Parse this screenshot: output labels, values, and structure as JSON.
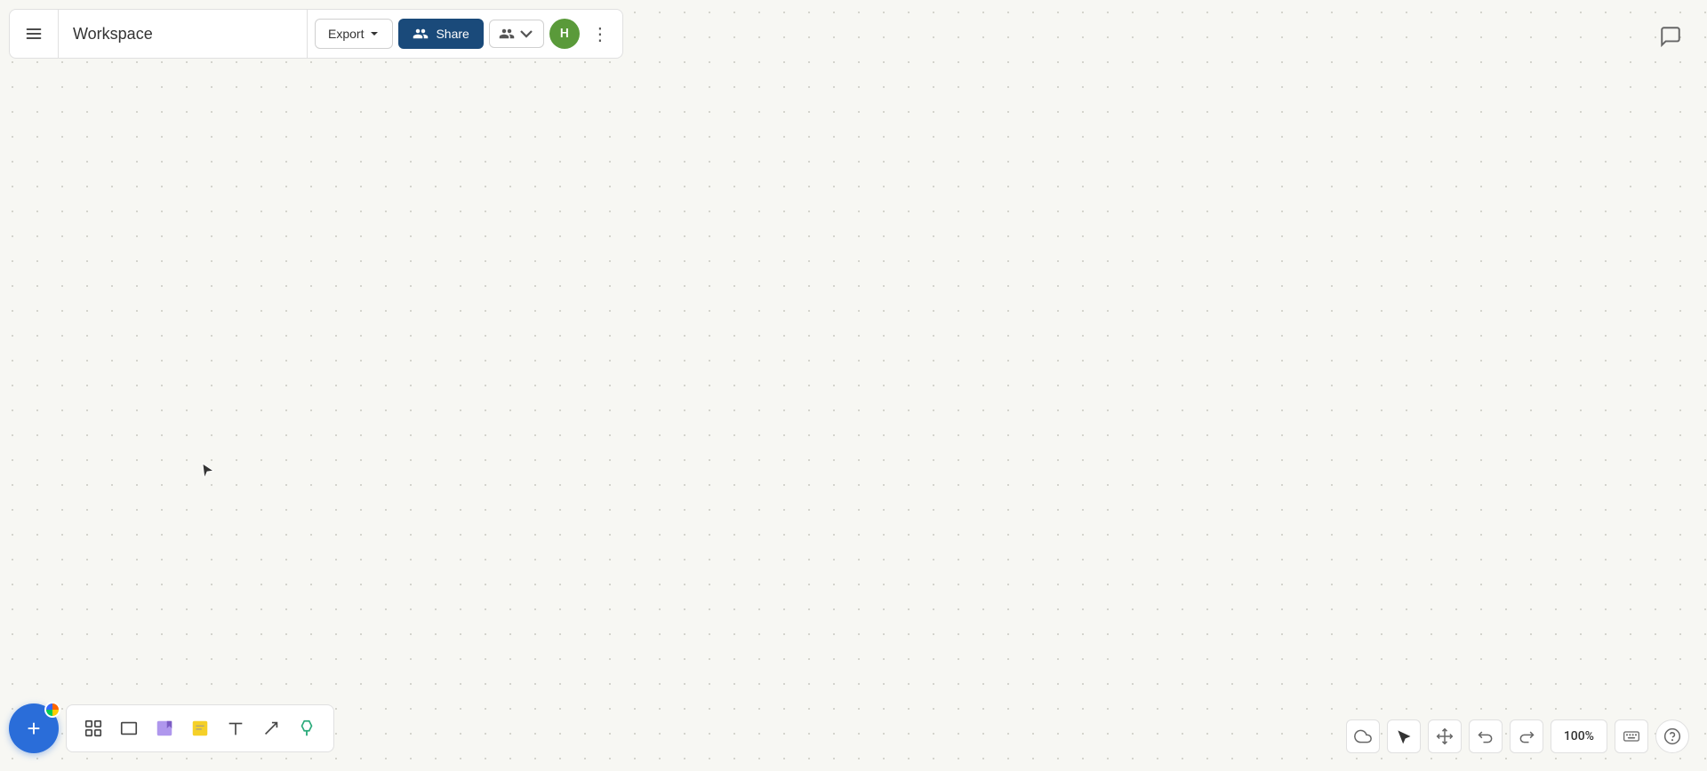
{
  "app": {
    "title": "Workspace"
  },
  "toolbar": {
    "menu_label": "Menu",
    "title": "Workspace",
    "export_label": "Export",
    "share_label": "Share",
    "zoom_value": "100%"
  },
  "user": {
    "avatar_letter": "H",
    "avatar_color": "#5a9a3a"
  },
  "tools": {
    "add_label": "+",
    "items": [
      {
        "name": "frames",
        "icon": "⬚",
        "label": "Frames"
      },
      {
        "name": "rectangle",
        "icon": "□",
        "label": "Rectangle"
      },
      {
        "name": "sticky",
        "icon": "▭",
        "label": "Sticky Note"
      },
      {
        "name": "note",
        "icon": "◨",
        "label": "Note"
      },
      {
        "name": "text",
        "icon": "T",
        "label": "Text"
      },
      {
        "name": "line",
        "icon": "↗",
        "label": "Line"
      },
      {
        "name": "highlight",
        "icon": "✐",
        "label": "Highlight"
      }
    ]
  },
  "bottom_right": {
    "cloud_label": "Cloud Save",
    "cursor_label": "Cursor",
    "move_label": "Move",
    "undo_label": "Undo",
    "redo_label": "Redo",
    "zoom_value": "100%",
    "keyboard_label": "Keyboard Shortcuts",
    "help_label": "Help"
  },
  "icons": {
    "menu": "☰",
    "chevron_down": "▾",
    "share_group": "👥",
    "more_vert": "⋮",
    "chat": "💬",
    "cloud": "☁",
    "cursor_arrow": "↖",
    "move": "✥",
    "undo": "↩",
    "redo": "↪",
    "keyboard": "⌨",
    "help": "?"
  }
}
